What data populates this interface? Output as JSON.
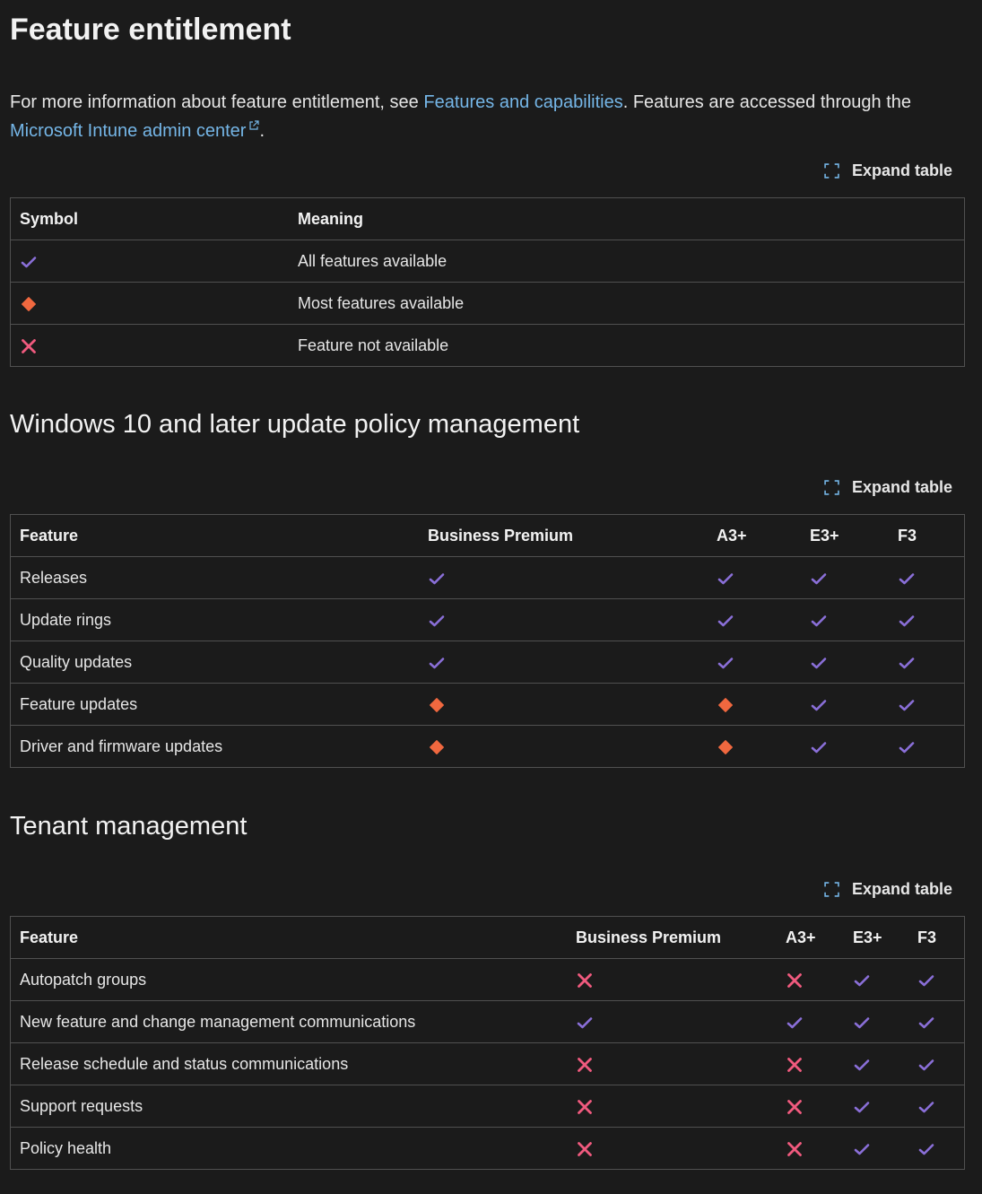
{
  "colors": {
    "background": "#1b1b1b",
    "link": "#75b6e7",
    "check": "#8a6fd8",
    "diamond": "#f0683f",
    "cross": "#f05a7e",
    "border": "#505050"
  },
  "section1": {
    "title": "Feature entitlement",
    "intro_before": "For more information about feature entitlement, see ",
    "intro_link1": "Features and capabilities",
    "intro_middle": ". Features are accessed through the ",
    "intro_link2": "Microsoft Intune admin center",
    "intro_end": ".",
    "expand_label": "Expand table",
    "table": {
      "headers": [
        "Symbol",
        "Meaning"
      ],
      "rows": [
        {
          "symbol": "check",
          "meaning": "All features available"
        },
        {
          "symbol": "diamond",
          "meaning": "Most features available"
        },
        {
          "symbol": "cross",
          "meaning": "Feature not available"
        }
      ]
    }
  },
  "section2": {
    "title": "Windows 10 and later update policy management",
    "expand_label": "Expand table",
    "table": {
      "headers": [
        "Feature",
        "Business Premium",
        "A3+",
        "E3+",
        "F3"
      ],
      "rows": [
        {
          "feature": "Releases",
          "cells": [
            "check",
            "check",
            "check",
            "check"
          ]
        },
        {
          "feature": "Update rings",
          "cells": [
            "check",
            "check",
            "check",
            "check"
          ]
        },
        {
          "feature": "Quality updates",
          "cells": [
            "check",
            "check",
            "check",
            "check"
          ]
        },
        {
          "feature": "Feature updates",
          "cells": [
            "diamond",
            "diamond",
            "check",
            "check"
          ]
        },
        {
          "feature": "Driver and firmware updates",
          "cells": [
            "diamond",
            "diamond",
            "check",
            "check"
          ]
        }
      ]
    }
  },
  "section3": {
    "title": "Tenant management",
    "expand_label": "Expand table",
    "table": {
      "headers": [
        "Feature",
        "Business Premium",
        "A3+",
        "E3+",
        "F3"
      ],
      "rows": [
        {
          "feature": "Autopatch groups",
          "cells": [
            "cross",
            "cross",
            "check",
            "check"
          ]
        },
        {
          "feature": "New feature and change management communications",
          "cells": [
            "check",
            "check",
            "check",
            "check"
          ]
        },
        {
          "feature": "Release schedule and status communications",
          "cells": [
            "cross",
            "cross",
            "check",
            "check"
          ]
        },
        {
          "feature": "Support requests",
          "cells": [
            "cross",
            "cross",
            "check",
            "check"
          ]
        },
        {
          "feature": "Policy health",
          "cells": [
            "cross",
            "cross",
            "check",
            "check"
          ]
        }
      ]
    }
  }
}
